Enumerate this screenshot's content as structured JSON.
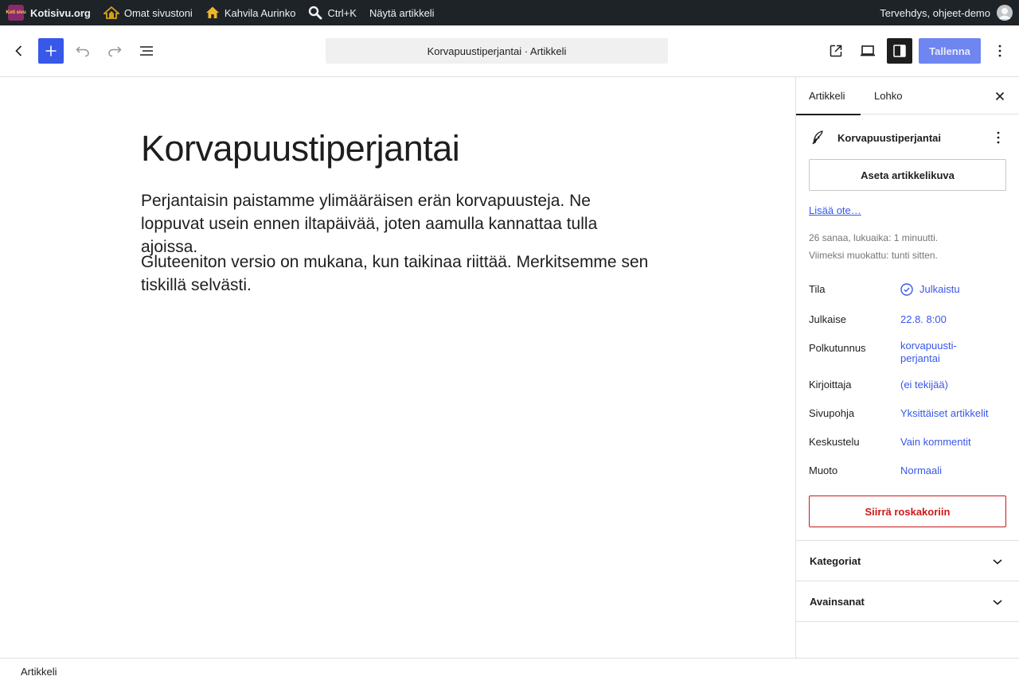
{
  "adminbar": {
    "site_logo_text": "Koti sivu",
    "site_name": "Kotisivu.org",
    "my_sites": "Omat sivustoni",
    "current_site": "Kahvila Aurinko",
    "search_shortcut": "Ctrl+K",
    "view_post": "Näytä artikkeli",
    "greeting": "Tervehdys, ohjeet-demo"
  },
  "header": {
    "document_title": "Korvapuustiperjantai · Artikkeli",
    "save_label": "Tallenna",
    "colors": {
      "primary": "#3858e9",
      "save_disabled": "#6f85f0"
    }
  },
  "editor": {
    "title": "Korvapuustiperjantai",
    "paragraphs": [
      "Perjantaisin paistamme ylimääräisen erän korvapuusteja. Ne loppuvat usein ennen iltapäivää, joten aamulla kannattaa tulla ajoissa.",
      "Gluteeniton versio on mukana, kun taikinaa riittää. Merkitsemme sen tiskillä selvästi."
    ]
  },
  "sidebar": {
    "tabs": [
      "Artikkeli",
      "Lohko"
    ],
    "active_tab": "Artikkeli",
    "post_name": "Korvapuustiperjantai",
    "featured_image_button": "Aseta artikkelikuva",
    "excerpt_link": "Lisää ote…",
    "meta_words": "26 sanaa, lukuaika: 1 minuutti.",
    "meta_modified": "Viimeksi muokattu: tunti sitten.",
    "rows": [
      {
        "label": "Tila",
        "value": "Julkaistu"
      },
      {
        "label": "Julkaise",
        "value": "22.8. 8:00"
      },
      {
        "label": "Polkutunnus",
        "value_line1": "korvapuusti-",
        "value_line2": "perjantai"
      },
      {
        "label": "Kirjoittaja",
        "value": "(ei tekijää)"
      },
      {
        "label": "Sivupohja",
        "value": "Yksittäiset artikkelit"
      },
      {
        "label": "Keskustelu",
        "value": "Vain kommentit"
      },
      {
        "label": "Muoto",
        "value": "Normaali"
      }
    ],
    "trash_button": "Siirrä roskakoriin",
    "panels": [
      "Kategoriat",
      "Avainsanat"
    ]
  },
  "footer": {
    "breadcrumb": "Artikkeli"
  }
}
